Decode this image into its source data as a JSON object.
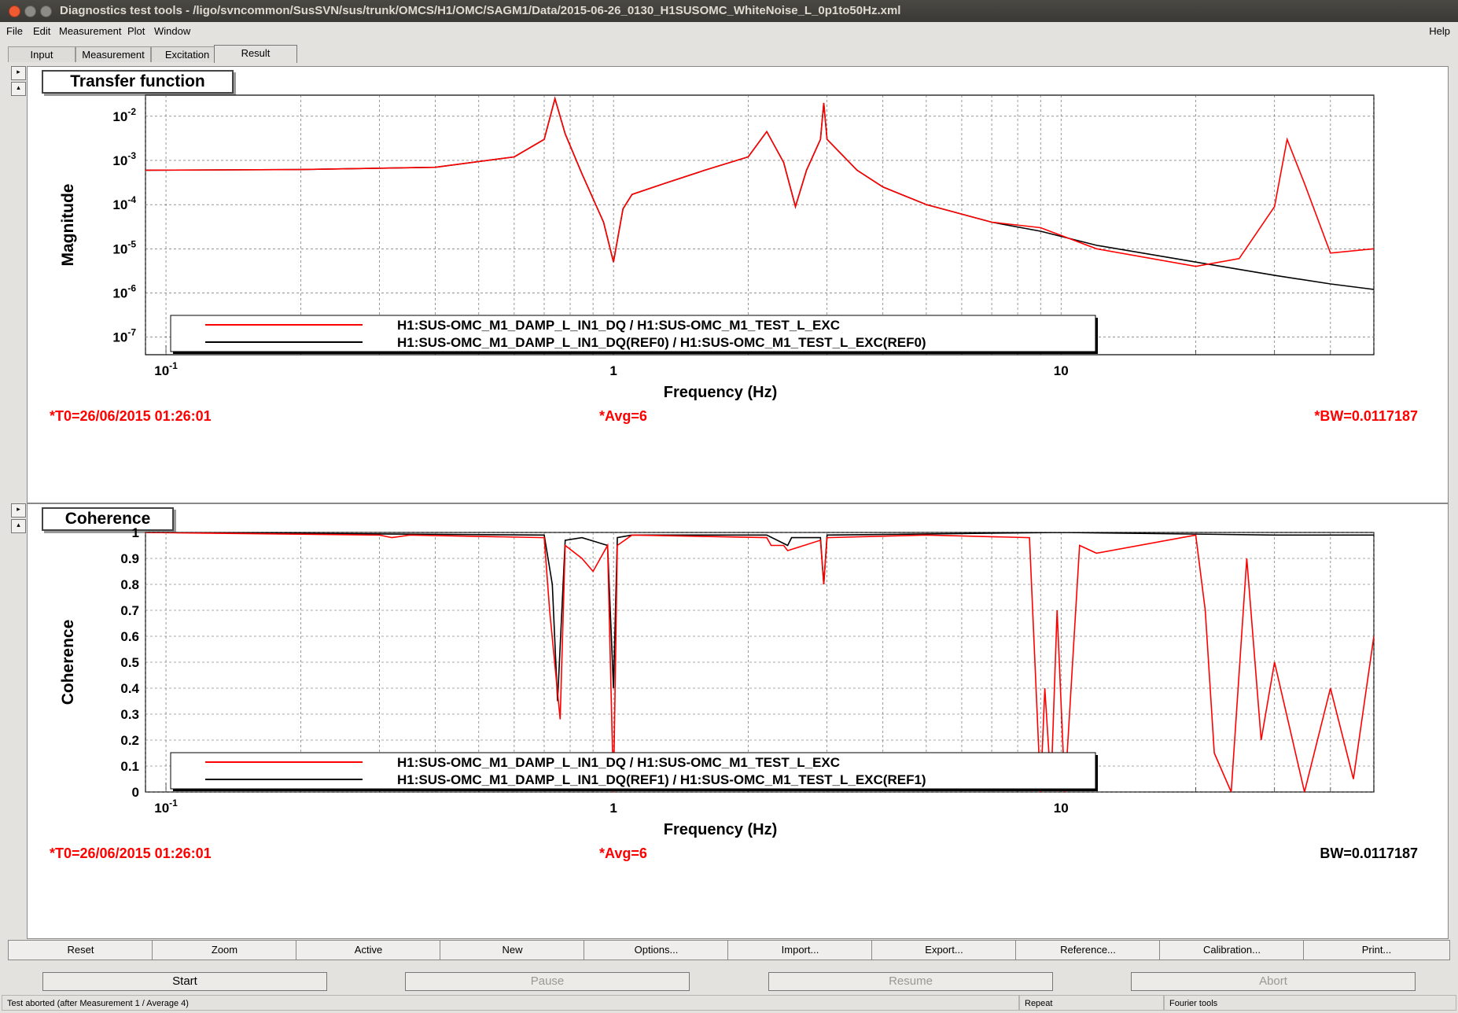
{
  "window": {
    "title": "Diagnostics test tools - /ligo/svncommon/SusSVN/sus/trunk/OMCS/H1/OMC/SAGM1/Data/2015-06-26_0130_H1SUSOMC_WhiteNoise_L_0p1to50Hz.xml"
  },
  "menubar": {
    "items": [
      "File",
      "Edit",
      "Measurement",
      "Plot",
      "Window"
    ],
    "help": "Help"
  },
  "tabs": [
    "Input",
    "Measurement",
    "Excitation",
    "Result"
  ],
  "active_tab": "Result",
  "colors": {
    "active": "#ff0000",
    "reference": "#000000",
    "info_red": "#ff0000"
  },
  "plots": {
    "transfer": {
      "title": "Transfer function",
      "ylabel": "Magnitude",
      "xlabel": "Frequency (Hz)",
      "yticks": [
        "10^-7",
        "10^-6",
        "10^-5",
        "10^-4",
        "10^-3",
        "10^-2"
      ],
      "xticks": [
        "10^-1",
        "1",
        "10"
      ],
      "legend": [
        "H1:SUS-OMC_M1_DAMP_L_IN1_DQ / H1:SUS-OMC_M1_TEST_L_EXC",
        "H1:SUS-OMC_M1_DAMP_L_IN1_DQ(REF0) / H1:SUS-OMC_M1_TEST_L_EXC(REF0)"
      ],
      "info": {
        "t0": "*T0=26/06/2015 01:26:01",
        "avg": "*Avg=6",
        "bw": "*BW=0.0117187"
      }
    },
    "coherence": {
      "title": "Coherence",
      "ylabel": "Coherence",
      "xlabel": "Frequency (Hz)",
      "yticks": [
        "0",
        "0.1",
        "0.2",
        "0.3",
        "0.4",
        "0.5",
        "0.6",
        "0.7",
        "0.8",
        "0.9",
        "1"
      ],
      "xticks": [
        "10^-1",
        "1",
        "10"
      ],
      "legend": [
        "H1:SUS-OMC_M1_DAMP_L_IN1_DQ / H1:SUS-OMC_M1_TEST_L_EXC",
        "H1:SUS-OMC_M1_DAMP_L_IN1_DQ(REF1) / H1:SUS-OMC_M1_TEST_L_EXC(REF1)"
      ],
      "info": {
        "t0": "*T0=26/06/2015 01:26:01",
        "avg": "*Avg=6",
        "bw": "BW=0.0117187"
      }
    }
  },
  "chart_data": [
    {
      "type": "line",
      "title": "Transfer function",
      "xlabel": "Frequency (Hz)",
      "ylabel": "Magnitude",
      "xscale": "log",
      "yscale": "log",
      "xlim": [
        0.09,
        50
      ],
      "ylim": [
        4e-08,
        0.03
      ],
      "grid": true,
      "legend_position": "bottom",
      "series": [
        {
          "name": "H1:SUS-OMC_M1_DAMP_L_IN1_DQ / H1:SUS-OMC_M1_TEST_L_EXC",
          "color": "#ff0000",
          "x": [
            0.09,
            0.2,
            0.4,
            0.6,
            0.7,
            0.74,
            0.78,
            0.85,
            0.95,
            1.0,
            1.05,
            1.1,
            1.3,
            1.6,
            2.0,
            2.2,
            2.4,
            2.55,
            2.7,
            2.9,
            2.95,
            3.0,
            3.5,
            4.0,
            5.0,
            7.0,
            9.0,
            12.0,
            20.0,
            25.0,
            30.0,
            32.0,
            35.0,
            40.0,
            50.0
          ],
          "y": [
            0.0006,
            0.00062,
            0.0007,
            0.0012,
            0.003,
            0.025,
            0.004,
            0.0005,
            4e-05,
            5e-06,
            8e-05,
            0.00017,
            0.0003,
            0.0006,
            0.0012,
            0.0045,
            0.0009,
            9e-05,
            0.0006,
            0.003,
            0.02,
            0.003,
            0.0006,
            0.00025,
            0.0001,
            4e-05,
            3e-05,
            1e-05,
            4e-06,
            6e-06,
            9e-05,
            0.003,
            0.0003,
            8e-06,
            1e-05
          ]
        },
        {
          "name": "H1:SUS-OMC_M1_DAMP_L_IN1_DQ(REF0) / H1:SUS-OMC_M1_TEST_L_EXC(REF0)",
          "color": "#000000",
          "x": [
            0.09,
            0.2,
            0.4,
            0.6,
            0.7,
            0.74,
            0.78,
            0.85,
            0.95,
            1.0,
            1.05,
            1.1,
            1.3,
            1.6,
            2.0,
            2.2,
            2.4,
            2.55,
            2.7,
            2.9,
            2.95,
            3.0,
            3.5,
            4.0,
            5.0,
            7.0,
            9.0,
            12.0,
            20.0,
            30.0,
            40.0,
            50.0
          ],
          "y": [
            0.0006,
            0.00062,
            0.0007,
            0.0012,
            0.003,
            0.025,
            0.004,
            0.0005,
            4e-05,
            5e-06,
            8e-05,
            0.00017,
            0.0003,
            0.0006,
            0.0012,
            0.0045,
            0.0009,
            9e-05,
            0.0006,
            0.003,
            0.02,
            0.003,
            0.0006,
            0.00025,
            0.0001,
            4e-05,
            2.5e-05,
            1.2e-05,
            5e-06,
            2.5e-06,
            1.6e-06,
            1.2e-06
          ]
        }
      ]
    },
    {
      "type": "line",
      "title": "Coherence",
      "xlabel": "Frequency (Hz)",
      "ylabel": "Coherence",
      "xscale": "log",
      "xlim": [
        0.09,
        50
      ],
      "ylim": [
        0,
        1
      ],
      "grid": true,
      "legend_position": "bottom",
      "series": [
        {
          "name": "H1:SUS-OMC_M1_DAMP_L_IN1_DQ / H1:SUS-OMC_M1_TEST_L_EXC",
          "color": "#ff0000",
          "x": [
            0.09,
            0.3,
            0.32,
            0.35,
            0.7,
            0.72,
            0.76,
            0.78,
            0.85,
            0.9,
            0.97,
            1.0,
            1.02,
            1.1,
            2.2,
            2.25,
            2.4,
            2.45,
            2.9,
            2.95,
            3.0,
            5.0,
            8.5,
            9.0,
            9.2,
            9.5,
            9.8,
            10.2,
            11.0,
            12.0,
            20.0,
            21.0,
            22.0,
            24.0,
            26.0,
            28.0,
            30.0,
            35.0,
            40.0,
            45.0,
            50.0
          ],
          "y": [
            1.0,
            0.99,
            0.98,
            0.99,
            0.98,
            0.7,
            0.28,
            0.95,
            0.9,
            0.85,
            0.95,
            0.0,
            0.95,
            0.99,
            0.98,
            0.95,
            0.95,
            0.93,
            0.97,
            0.8,
            0.98,
            0.99,
            0.98,
            0.0,
            0.4,
            0.02,
            0.7,
            0.0,
            0.95,
            0.92,
            0.99,
            0.7,
            0.15,
            0.0,
            0.9,
            0.2,
            0.5,
            0.0,
            0.4,
            0.05,
            0.6
          ]
        },
        {
          "name": "H1:SUS-OMC_M1_DAMP_L_IN1_DQ(REF1) / H1:SUS-OMC_M1_TEST_L_EXC(REF1)",
          "color": "#000000",
          "x": [
            0.09,
            0.7,
            0.73,
            0.75,
            0.78,
            0.85,
            0.97,
            1.0,
            1.02,
            1.1,
            2.2,
            2.45,
            2.5,
            2.9,
            2.95,
            3.0,
            10.0,
            30.0,
            50.0
          ],
          "y": [
            1.0,
            0.99,
            0.8,
            0.35,
            0.97,
            0.98,
            0.95,
            0.4,
            0.98,
            0.99,
            0.99,
            0.95,
            0.98,
            0.98,
            0.8,
            0.99,
            1.0,
            0.99,
            0.99
          ]
        }
      ]
    }
  ],
  "toolbar": [
    "Reset",
    "Zoom",
    "Active",
    "New",
    "Options...",
    "Import...",
    "Export...",
    "Reference...",
    "Calibration...",
    "Print..."
  ],
  "controls": {
    "start": "Start",
    "pause": "Pause",
    "resume": "Resume",
    "abort": "Abort"
  },
  "statusbar": {
    "message": "Test aborted (after Measurement 1 / Average 4)",
    "mode": "Repeat",
    "tool": "Fourier tools"
  }
}
